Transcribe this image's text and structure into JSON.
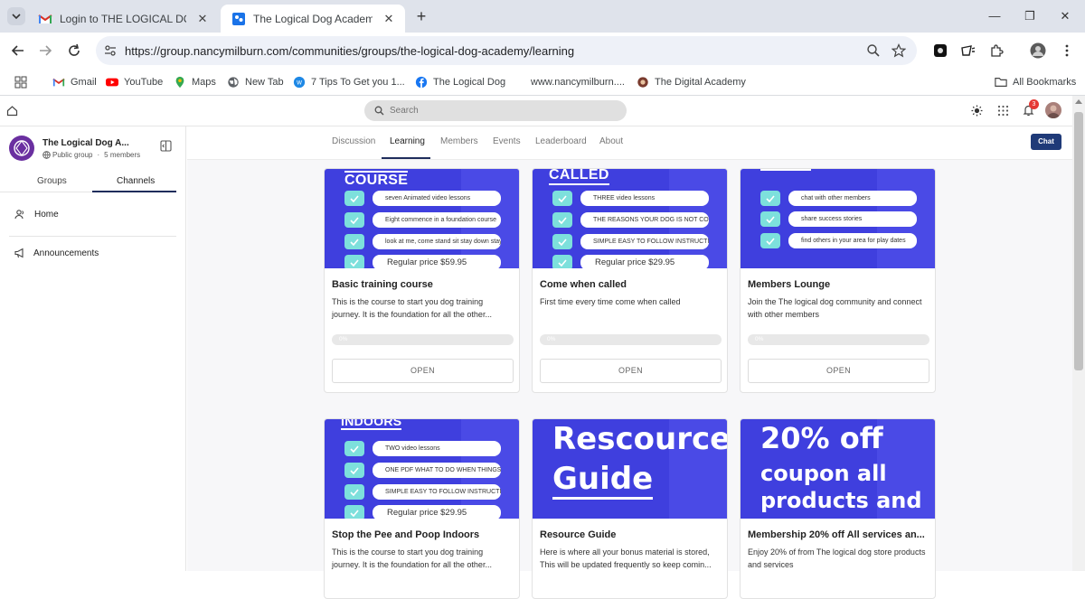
{
  "browser": {
    "tabs": [
      {
        "title": "Login to THE LOGICAL DOG CL"
      },
      {
        "title": "The Logical Dog Academy"
      }
    ],
    "url": "https://group.nancymilburn.com/communities/groups/the-logical-dog-academy/learning",
    "bookmarks": [
      "Gmail",
      "YouTube",
      "Maps",
      "New Tab",
      "7 Tips To Get you 1...",
      "The Logical Dog",
      "www.nancymilburn....",
      "The Digital Academy"
    ],
    "all_bookmarks": "All Bookmarks"
  },
  "topbar": {
    "search_placeholder": "Search",
    "notification_count": "3"
  },
  "sidebar": {
    "group_name": "The Logical Dog A...",
    "group_type": "Public group",
    "members": "5 members",
    "tabs": [
      "Groups",
      "Channels"
    ],
    "items": [
      "Home",
      "Announcements"
    ]
  },
  "main": {
    "tabs": [
      "Discussion",
      "Learning",
      "Members",
      "Events",
      "Leaderboard",
      "About"
    ],
    "chat_label": "Chat",
    "open_label": "OPEN",
    "progress_label": "0%",
    "courses": [
      {
        "thumb_heading": "COURSE",
        "thumb_rows": [
          "seven Animated  video lessons",
          "Eight commence  in a foundation course",
          "look at me, come stand sit stay down stay standing stay come  walk nice"
        ],
        "thumb_price": "Regular price $59.95",
        "title": "Basic training course",
        "desc": "This is the course to start you dog training journey. It is the foundation for all the other..."
      },
      {
        "thumb_heading": "CALLED",
        "thumb_rows": [
          "THREE video lessons",
          "THE REASONS YOUR DOG IS NOT COMING",
          "SIMPLE EASY TO FOLLOW INSTRUCTIONS"
        ],
        "thumb_price": "Regular price $29.95",
        "title": "Come when called",
        "desc": "First time every time come when called"
      },
      {
        "thumb_heading": "",
        "thumb_rows": [
          "chat with other members",
          "share success stories",
          "find others in your area for play dates"
        ],
        "thumb_price": "",
        "title": "Members Lounge",
        "desc": "Join the The logical dog community and connect with other members"
      },
      {
        "thumb_heading": "INDOORS",
        "thumb_rows": [
          "TWO video lessons",
          "ONE PDF WHAT TO DO WHEN THINGS GO WRONG",
          "SIMPLE EASY TO FOLLOW INSTRUCTIONS"
        ],
        "thumb_price": "Regular price $29.95",
        "title": "Stop the Pee and Poop Indoors",
        "desc": "This is the course to start you dog training journey. It is the foundation for all the other..."
      },
      {
        "thumb_lines": [
          "Rescource",
          "Guide"
        ],
        "title": "Resource Guide",
        "desc": "Here is where all your bonus material is stored, This will be updated frequently so keep comin..."
      },
      {
        "thumb_lines": [
          "20% off",
          "coupon all",
          "products and"
        ],
        "title": "Membership 20% off All services an...",
        "desc": "Enjoy 20% of from The logical dog store products and services"
      }
    ]
  },
  "colors": {
    "accent": "#2e3a8c",
    "thumb_bg": "#3f3fde",
    "check": "#7de0dc"
  }
}
